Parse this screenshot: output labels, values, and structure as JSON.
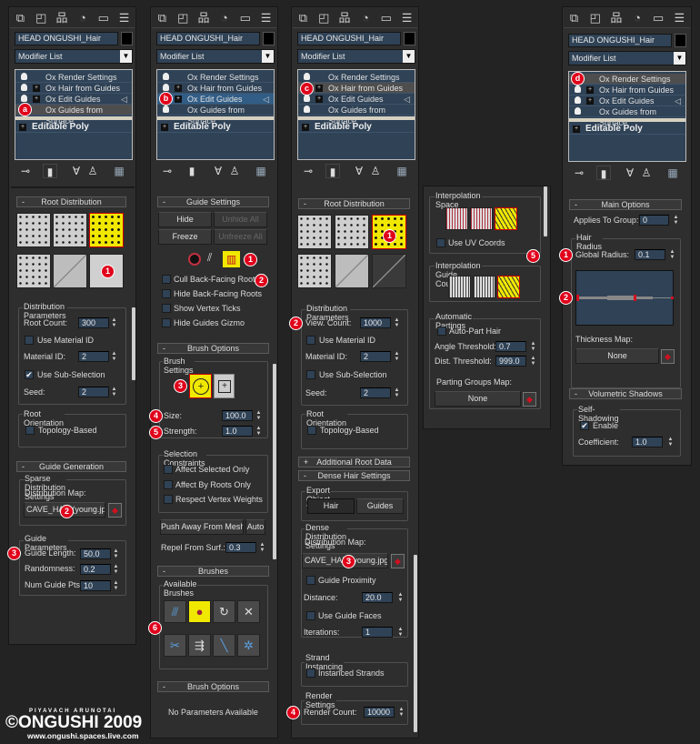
{
  "common": {
    "object_name": "HEAD ONGUSHI_Hair",
    "modifier_list": "Modifier List",
    "stack": [
      "Ox Render Settings",
      "Ox Hair from Guides",
      "Ox Edit Guides",
      "Ox Guides from Surface"
    ],
    "base_object": "Editable Poly",
    "tab_icons": [
      "create-icon",
      "modify-icon",
      "hierarchy-icon",
      "motion-icon",
      "display-icon",
      "utilities-icon"
    ],
    "toolbar_icons": [
      "pin-stack-icon",
      "show-end-result-icon",
      "make-unique-icon",
      "remove-modifier-icon",
      "configure-sets-icon"
    ],
    "accent": "#e0001a",
    "highlight": "#f1e800",
    "field_bg": "#2f4256"
  },
  "p1": {
    "badges": {
      "a": "a",
      "one": "1",
      "two": "2",
      "three": "3"
    },
    "root_distribution": "Root Distribution",
    "dist_params": "Distribution Parameters",
    "root_count_label": "Root Count:",
    "root_count": "300",
    "use_material_id": "Use Material ID",
    "material_id_label": "Material ID:",
    "material_id": "2",
    "use_sub_selection": "Use Sub-Selection",
    "seed_label": "Seed:",
    "seed": "2",
    "root_orientation": "Root Orientation",
    "topology_based": "Topology-Based",
    "guide_generation": "Guide Generation",
    "sparse": "Sparse Distribution Settings",
    "dist_map_label": "Distribution Map:",
    "dist_map": "CAVE_HAIR(young.jpg)",
    "guide_params": "Guide Parameters",
    "guide_length_label": "Guide Length:",
    "guide_length": "50.0",
    "randomness_label": "Randomness:",
    "randomness": "0.2",
    "num_pts_label": "Num Guide Pts:",
    "num_pts": "10"
  },
  "p2": {
    "badges": {
      "b": "b",
      "one": "1",
      "two": "2",
      "three": "3",
      "four": "4",
      "five": "5",
      "six": "6"
    },
    "guide_settings": "Guide Settings",
    "hide": "Hide",
    "unhide_all": "Unhide All",
    "freeze": "Freeze",
    "unfreeze_all": "Unfreeze All",
    "cull": "Cull Back-Facing Roots",
    "hide_back": "Hide Back-Facing Roots",
    "show_ticks": "Show Vertex Ticks",
    "hide_gizmo": "Hide Guides Gizmo",
    "brush_options": "Brush Options",
    "brush_settings": "Brush Settings",
    "size_label": "Size:",
    "size": "100.0",
    "strength_label": "Strength:",
    "strength": "1.0",
    "sel_constraints": "Selection Constraints",
    "affect_selected": "Affect Selected Only",
    "affect_roots": "Affect By Roots Only",
    "respect_weights": "Respect Vertex Weights",
    "push_away": "Push Away From Mesh",
    "auto": "Auto",
    "repel_label": "Repel From Surf.:",
    "repel": "0.3",
    "brushes": "Brushes",
    "available_brushes": "Available Brushes",
    "brush_options2": "Brush Options",
    "no_params": "No Parameters Available"
  },
  "p3": {
    "badges": {
      "c": "c",
      "one": "1",
      "two": "2",
      "three": "3",
      "four": "4"
    },
    "root_distribution": "Root Distribution",
    "dist_params": "Distribution Parameters",
    "view_count_label": "View. Count:",
    "view_count": "1000",
    "use_material_id": "Use Material ID",
    "material_id_label": "Material ID:",
    "material_id": "2",
    "use_sub_selection": "Use Sub-Selection",
    "seed_label": "Seed:",
    "seed": "2",
    "root_orientation": "Root Orientation",
    "topology_based": "Topology-Based",
    "additional_root": "Additional Root Data",
    "dense_hair": "Dense Hair Settings",
    "export_type": "Export Object Type",
    "hair": "Hair",
    "guides": "Guides",
    "dense_dist": "Dense Distribution Settings",
    "dist_map_label": "Distribution Map:",
    "dist_map": "CAVE_HAIR(young.jpg)",
    "guide_proximity": "Guide Proximity",
    "distance_label": "Distance:",
    "distance": "20.0",
    "use_guide_faces": "Use Guide Faces",
    "iterations_label": "Iterations:",
    "iterations": "1",
    "strand_instancing": "Strand Instancing",
    "instanced_strands": "Instanced Strands",
    "render_settings": "Render Settings",
    "render_count_label": "Render Count:",
    "render_count": "10000"
  },
  "p4": {
    "badge": "5",
    "interp_space": "Interpolation Space",
    "use_uv": "Use UV Coords",
    "interp_count": "Interpolation Guide Count",
    "auto_partings": "Automatic Partings",
    "auto_part": "Auto-Part Hair",
    "angle_label": "Angle Threshold:",
    "angle": "0.7",
    "dist_label": "Dist. Threshold:",
    "dist": "999.0",
    "parting_map": "Parting Groups Map:",
    "none": "None"
  },
  "p5": {
    "badges": {
      "d": "d",
      "one": "1",
      "two": "2"
    },
    "main_options": "Main Options",
    "applies_label": "Applies To Group:",
    "applies": "0",
    "hair_radius": "Hair Radius",
    "global_radius_label": "Global Radius:",
    "global_radius": "0.1",
    "thickness_map": "Thickness Map:",
    "none": "None",
    "vol_shadows": "Volumetric Shadows",
    "self_shadowing": "Self-Shadowing",
    "enable": "Enable",
    "coefficient_label": "Coefficient:",
    "coefficient": "1.0"
  },
  "watermark": {
    "author": "PIYAVACH ARUNOTAI",
    "brand": "©ONGUSHI 2009",
    "url": "www.ongushi.spaces.live.com"
  }
}
